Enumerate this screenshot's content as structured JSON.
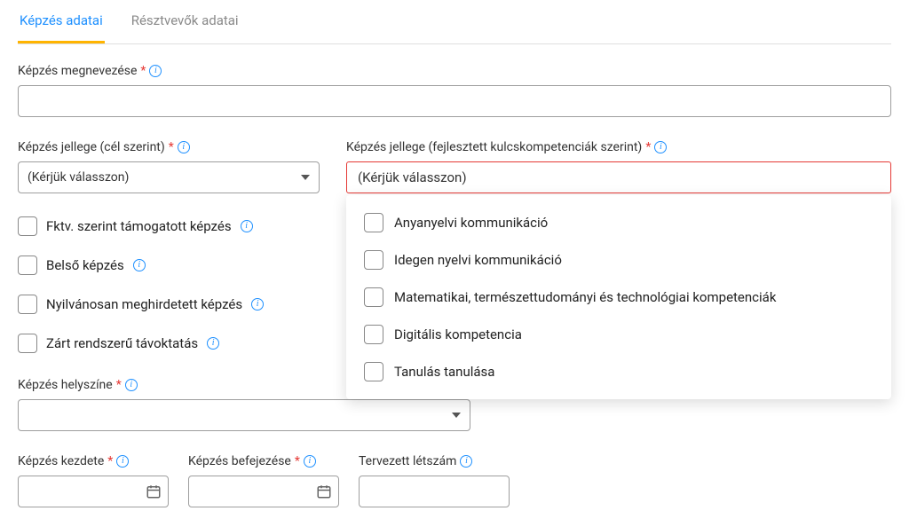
{
  "tabs": {
    "training_data": "Képzés adatai",
    "participants_data": "Résztvevők adatai"
  },
  "labels": {
    "training_name": "Képzés megnevezése",
    "training_type_goal": "Képzés jellege (cél szerint)",
    "training_type_competency": "Képzés jellege (fejlesztett kulcskompetenciák szerint)",
    "training_location": "Képzés helyszíne",
    "training_start": "Képzés kezdete",
    "training_end": "Képzés befejezése",
    "planned_headcount": "Tervezett létszám"
  },
  "select_placeholder": "(Kérjük válasszon)",
  "checkboxes": {
    "fktv_supported": "Fktv. szerint támogatott képzés",
    "internal_training": "Belső képzés",
    "publicly_announced": "Nyilvánosan meghirdetett képzés",
    "closed_distance": "Zárt rendszerű távoktatás"
  },
  "competency_options": [
    "Anyanyelvi kommunikáció",
    "Idegen nyelvi kommunikáció",
    "Matematikai, természettudományi és technológiai kompetenciák",
    "Digitális kompetencia",
    "Tanulás tanulása"
  ]
}
